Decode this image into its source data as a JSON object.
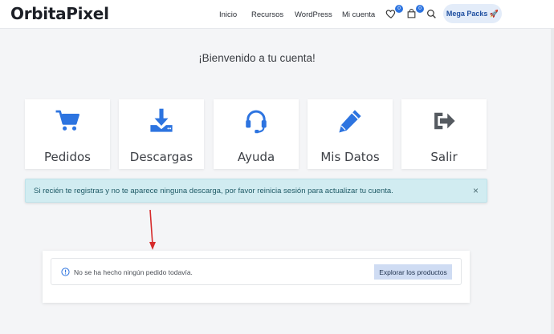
{
  "header": {
    "logo": "OrbitaPixel",
    "nav": [
      "Inicio",
      "Recursos",
      "WordPress",
      "Mi cuenta"
    ],
    "wishlist_count": "0",
    "cart_count": "0",
    "mega_packs": "Mega Packs 🚀"
  },
  "welcome": "¡Bienvenido a tu cuenta!",
  "cards": [
    {
      "label": "Pedidos",
      "icon": "cart-icon"
    },
    {
      "label": "Descargas",
      "icon": "download-icon"
    },
    {
      "label": "Ayuda",
      "icon": "headset-icon"
    },
    {
      "label": "Mis Datos",
      "icon": "pencil-icon"
    },
    {
      "label": "Salir",
      "icon": "logout-icon"
    }
  ],
  "notice": {
    "text": "Si recién te registras y no te aparece ninguna descarga, por favor reinicia sesión para actualizar tu cuenta.",
    "close": "×"
  },
  "orders": {
    "message": "No se ha hecho ningún pedido todavía.",
    "button": "Explorar los productos"
  },
  "colors": {
    "accent": "#2d74e0",
    "notice_bg": "#d1ecf1",
    "annotation_arrow": "#d62b2b"
  }
}
